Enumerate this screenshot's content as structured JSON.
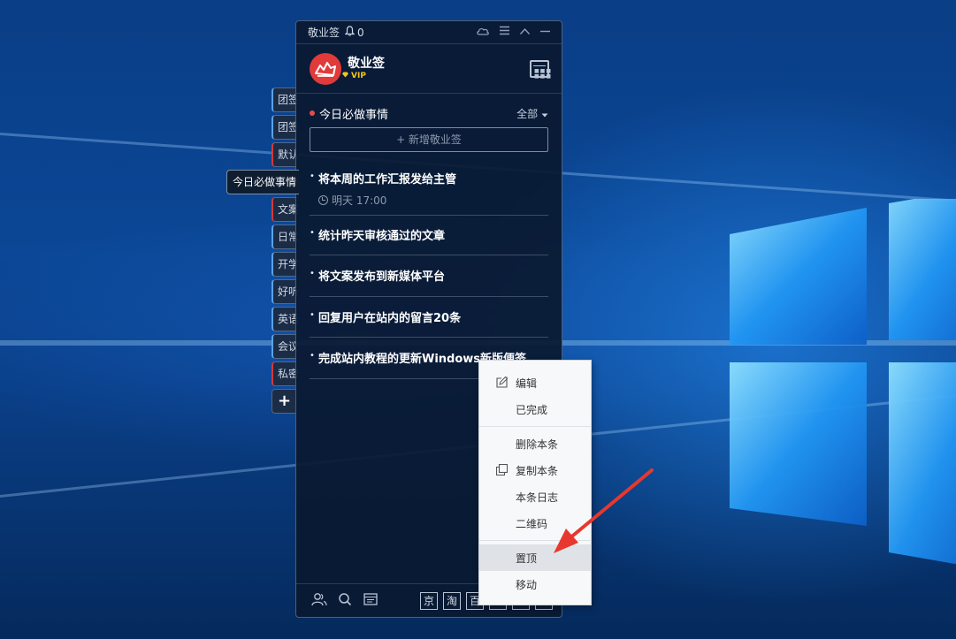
{
  "app": {
    "title": "敬业签",
    "notification_count": "0",
    "user_name": "敬业签",
    "vip_label": "VIP"
  },
  "side_tabs": [
    {
      "label": "团签",
      "color": "blue"
    },
    {
      "label": "团签",
      "color": "blue"
    },
    {
      "label": "默认",
      "color": "red"
    },
    {
      "label": "今日必做事情",
      "active": true
    },
    {
      "label": "文案",
      "color": "red"
    },
    {
      "label": "日常",
      "color": "blue"
    },
    {
      "label": "开学",
      "color": "blue"
    },
    {
      "label": "好听",
      "color": "blue"
    },
    {
      "label": "英语",
      "color": "blue"
    },
    {
      "label": "会议",
      "color": "blue"
    },
    {
      "label": "私密",
      "color": "red"
    },
    {
      "label": "+"
    }
  ],
  "section": {
    "title": "今日必做事情",
    "filter": "全部",
    "add_button": "+ 新增敬业签"
  },
  "tasks": [
    {
      "text": "将本周的工作汇报发给主管",
      "due": "明天 17:00"
    },
    {
      "text": "统计昨天审核通过的文章"
    },
    {
      "text": "将文案发布到新媒体平台"
    },
    {
      "text": "回复用户在站内的留言20条"
    },
    {
      "text": "完成站内教程的更新Windows新版便签"
    }
  ],
  "bottom_shortcuts": [
    "京",
    "淘",
    "百"
  ],
  "context_menu": {
    "items": [
      {
        "label": "编辑",
        "icon": "edit-icon"
      },
      {
        "label": "已完成"
      },
      {
        "label": "删除本条"
      },
      {
        "label": "复制本条",
        "icon": "copy-icon"
      },
      {
        "label": "本条日志"
      },
      {
        "label": "二维码"
      },
      {
        "label": "置顶",
        "highlighted": true
      },
      {
        "label": "移动"
      }
    ]
  },
  "colors": {
    "panel_bg": "#0a1930",
    "accent_red": "#e23a3a",
    "vip_gold": "#f5c518",
    "menu_highlight": "#dfe3e8",
    "annotation_arrow": "#e8372e"
  }
}
